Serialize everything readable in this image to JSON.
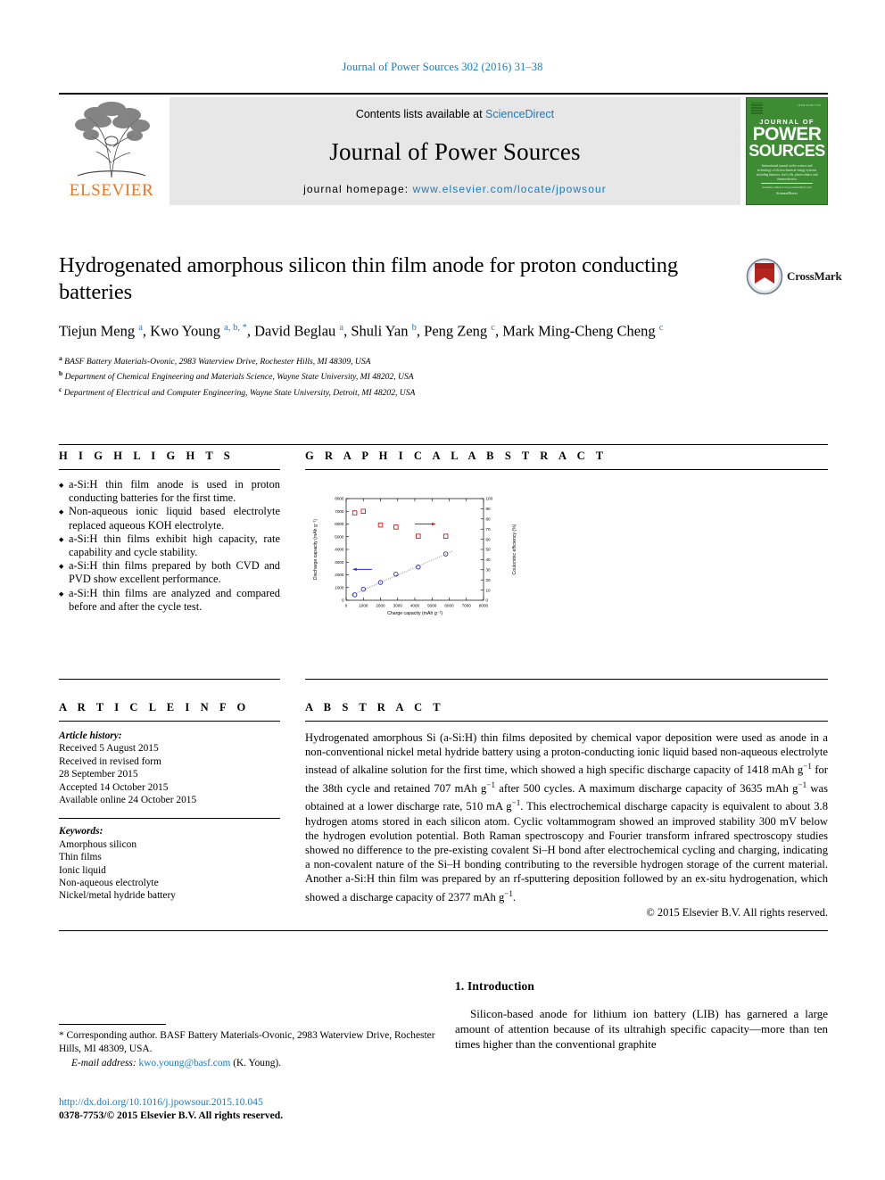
{
  "running_head": "Journal of Power Sources 302 (2016) 31–38",
  "masthead": {
    "publisher": "ELSEVIER",
    "contents_prefix": "Contents lists available at ",
    "contents_link": "ScienceDirect",
    "journal_name": "Journal of Power Sources",
    "homepage_prefix": "journal homepage: ",
    "homepage_url": "www.elsevier.com/locate/jpowsour",
    "cover": {
      "issn": "ISSN 0378-7753",
      "line1": "JOURNAL OF",
      "line2": "POWER",
      "line3": "SOURCES",
      "blurb": "International journal on the science and technology of electrochemical energy systems including batteries, fuel cells, photovoltaics and thermoelectrics",
      "foot1": "Available online at www.sciencedirect.com",
      "foot2": "ScienceDirect"
    }
  },
  "article": {
    "title": "Hydrogenated amorphous silicon thin film anode for proton conducting batteries",
    "authors_html": "Tiejun Meng <sup>a</sup>, Kwo Young <sup>a, b, *</sup>, David Beglau <sup>a</sup>, Shuli Yan <sup>b</sup>, Peng Zeng <sup>c</sup>, Mark Ming-Cheng Cheng <sup>c</sup>",
    "affiliations": [
      {
        "mark": "a",
        "text": "BASF Battery Materials-Ovonic, 2983 Waterview Drive, Rochester Hills, MI 48309, USA"
      },
      {
        "mark": "b",
        "text": "Department of Chemical Engineering and Materials Science, Wayne State University, MI 48202, USA"
      },
      {
        "mark": "c",
        "text": "Department of Electrical and Computer Engineering, Wayne State University, Detroit, MI 48202, USA"
      }
    ],
    "crossmark_label": "CrossMark"
  },
  "highlights": {
    "heading": "H I G H L I G H T S",
    "items": [
      "a-Si:H thin film anode is used in proton conducting batteries for the first time.",
      "Non-aqueous ionic liquid based electrolyte replaced aqueous KOH electrolyte.",
      "a-Si:H thin films exhibit high capacity, rate capability and cycle stability.",
      "a-Si:H thin films prepared by both CVD and PVD show excellent performance.",
      "a-Si:H thin films are analyzed and compared before and after the cycle test."
    ]
  },
  "graphical_abstract": {
    "heading": "G R A P H I C A L   A B S T R A C T"
  },
  "chart_data": {
    "type": "scatter",
    "title": "",
    "xlabel": "Charge capacity (mAh g⁻¹)",
    "ylabel": "Discharge capacity (mAh g⁻¹)",
    "y2label": "Coulombic efficiency (%)",
    "xlim": [
      0,
      8000
    ],
    "ylim": [
      0,
      8000
    ],
    "y2lim": [
      0,
      100
    ],
    "xticks": [
      0,
      1000,
      2000,
      3000,
      4000,
      5000,
      6000,
      7000,
      8000
    ],
    "yticks": [
      0,
      1000,
      2000,
      3000,
      4000,
      5000,
      6000,
      7000,
      8000
    ],
    "y2ticks": [
      0,
      10,
      20,
      30,
      40,
      50,
      60,
      70,
      80,
      90,
      100
    ],
    "grid": false,
    "series": [
      {
        "name": "Discharge capacity",
        "axis": "left",
        "marker": "open-circle",
        "color": "#2b2bbd",
        "x": [
          500,
          1000,
          2000,
          2900,
          4200,
          5800
        ],
        "y": [
          430,
          870,
          1400,
          2050,
          2610,
          3640
        ],
        "trendline": true,
        "arrow": {
          "x_from": 1500,
          "x_to": 400,
          "y": 2430,
          "direction": "left"
        }
      },
      {
        "name": "Coulombic efficiency",
        "axis": "right",
        "marker": "open-square",
        "color": "#c42020",
        "x": [
          500,
          1000,
          2000,
          2900,
          4200,
          5800
        ],
        "y": [
          86,
          87.5,
          74,
          72,
          63,
          63
        ],
        "arrow": {
          "x_from": 4000,
          "x_to": 5200,
          "y": 75,
          "direction": "right"
        }
      }
    ]
  },
  "article_info": {
    "heading": "A R T I C L E   I N F O",
    "history_label": "Article history:",
    "history": [
      "Received 5 August 2015",
      "Received in revised form",
      "28 September 2015",
      "Accepted 14 October 2015",
      "Available online 24 October 2015"
    ],
    "keywords_label": "Keywords:",
    "keywords": [
      "Amorphous silicon",
      "Thin films",
      "Ionic liquid",
      "Non-aqueous electrolyte",
      "Nickel/metal hydride battery"
    ]
  },
  "abstract": {
    "heading": "A B S T R A C T",
    "body_html": "Hydrogenated amorphous Si (a-Si:H) thin films deposited by chemical vapor deposition were used as anode in a non-conventional nickel metal hydride battery using a proton-conducting ionic liquid based non-aqueous electrolyte instead of alkaline solution for the first time, which showed a high specific discharge capacity of 1418 mAh g<sup class=\"sm\">&minus;1</sup> for the 38th cycle and retained 707 mAh g<sup class=\"sm\">&minus;1</sup> after 500 cycles. A maximum discharge capacity of 3635 mAh g<sup class=\"sm\">&minus;1</sup> was obtained at a lower discharge rate, 510 mA g<sup class=\"sm\">&minus;1</sup>. This electrochemical discharge capacity is equivalent to about 3.8 hydrogen atoms stored in each silicon atom. Cyclic voltammogram showed an improved stability 300 mV below the hydrogen evolution potential. Both Raman spectroscopy and Fourier transform infrared spectroscopy studies showed no difference to the pre-existing covalent Si&ndash;H bond after electrochemical cycling and charging, indicating a non-covalent nature of the Si&ndash;H bonding contributing to the reversible hydrogen storage of the current material. Another a-Si:H thin film was prepared by an rf-sputtering deposition followed by an ex-situ hydrogenation, which showed a discharge capacity of 2377 mAh g<sup class=\"sm\">&minus;1</sup>.",
    "copyright": "© 2015 Elsevier B.V. All rights reserved."
  },
  "footnote": {
    "corresponding": "* Corresponding author. BASF Battery Materials-Ovonic, 2983 Waterview Drive, Rochester Hills, MI 48309, USA.",
    "email_label": "E-mail address: ",
    "email": "kwo.young@basf.com",
    "email_suffix": " (K. Young)."
  },
  "footer": {
    "doi": "http://dx.doi.org/10.1016/j.jpowsour.2015.10.045",
    "issn_line": "0378-7753/© 2015 Elsevier B.V. All rights reserved."
  },
  "introduction": {
    "heading": "1. Introduction",
    "paragraph": "Silicon-based anode for lithium ion battery (LIB) has garnered a large amount of attention because of its ultrahigh specific capacity—more than ten times higher than the conventional graphite"
  }
}
